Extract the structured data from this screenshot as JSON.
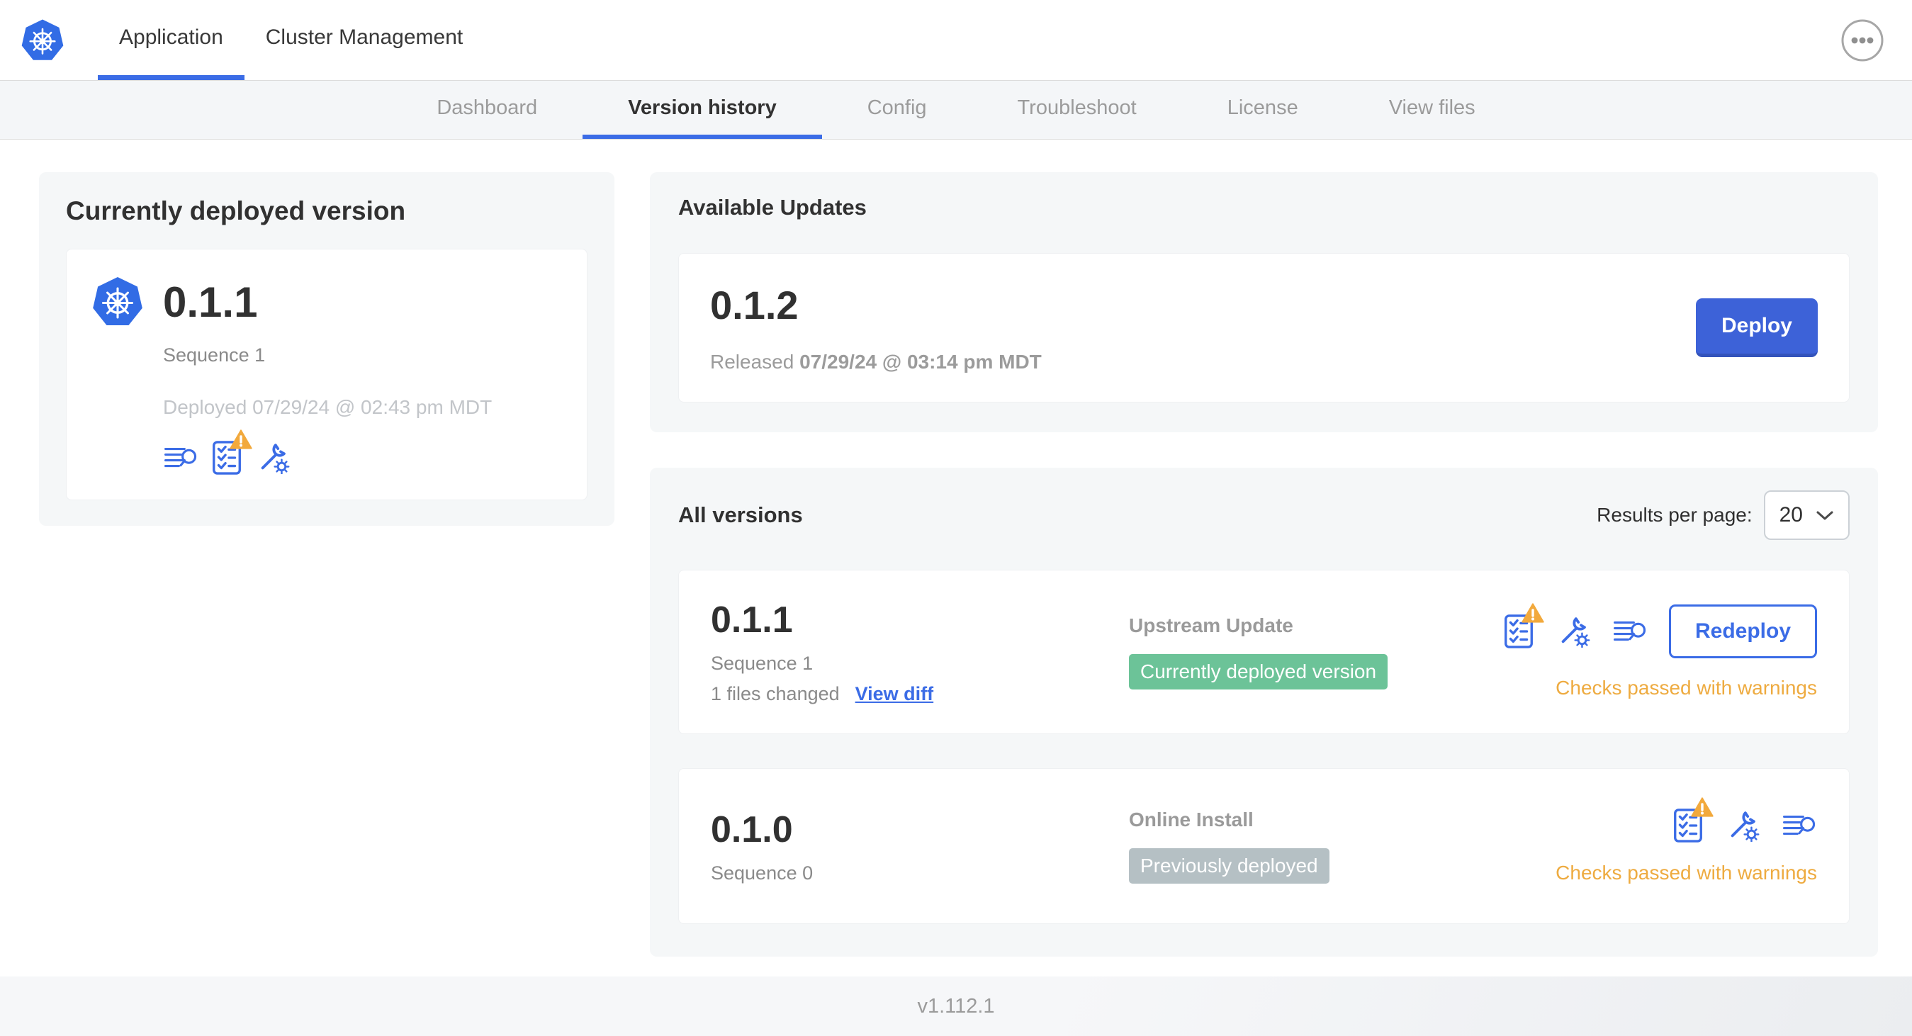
{
  "header": {
    "tabs": [
      {
        "label": "Application",
        "active": true
      },
      {
        "label": "Cluster Management",
        "active": false
      }
    ]
  },
  "subnav": {
    "tabs": [
      "Dashboard",
      "Version history",
      "Config",
      "Troubleshoot",
      "License",
      "View files"
    ],
    "active": "Version history"
  },
  "current_version": {
    "title": "Currently deployed version",
    "version": "0.1.1",
    "sequence": "Sequence 1",
    "deployed": "Deployed 07/29/24 @ 02:43 pm MDT",
    "icons": [
      "diff-lines-icon",
      "preflight-checklist-warning-icon",
      "config-wrench-icon"
    ]
  },
  "available_updates": {
    "title": "Available Updates",
    "version": "0.1.2",
    "released_prefix": "Released",
    "released_date": "07/29/24 @ 03:14 pm MDT",
    "deploy_label": "Deploy"
  },
  "all_versions": {
    "title": "All versions",
    "results_per_page_label": "Results per page:",
    "results_per_page_value": "20",
    "rows": [
      {
        "version": "0.1.1",
        "sequence": "Sequence 1",
        "files_changed": "1 files changed",
        "view_diff_label": "View diff",
        "source": "Upstream Update",
        "badge": "Currently deployed version",
        "badge_type": "green",
        "action_label": "Redeploy",
        "status": "Checks passed with warnings"
      },
      {
        "version": "0.1.0",
        "sequence": "Sequence 0",
        "source": "Online Install",
        "badge": "Previously deployed",
        "badge_type": "gray",
        "status": "Checks passed with warnings"
      }
    ]
  },
  "footer": {
    "app_version": "v1.112.1"
  },
  "colors": {
    "primary_blue": "#3b6ce6",
    "deploy_blue": "#3d62d8",
    "kubernetes_blue": "#326ce5",
    "badge_green": "#6cc398",
    "badge_gray": "#b5c0c4",
    "warning_amber": "#eeab40",
    "panel_gray": "#f5f7f8",
    "subnav_gray": "#f4f6f8",
    "text_dark": "#323232",
    "text_gray": "#8a8a8a",
    "text_light": "#9b9b9b"
  }
}
